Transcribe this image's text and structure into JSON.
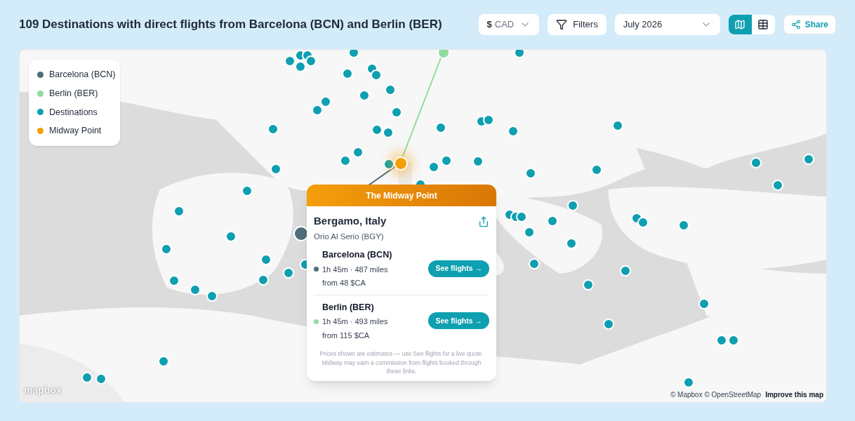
{
  "title": "109 Destinations with direct flights from Barcelona (BCN) and Berlin (BER)",
  "currency": {
    "symbol": "$",
    "code": "CAD"
  },
  "filters_label": "Filters",
  "month": "July 2026",
  "view_toggle": [
    {
      "kind": "map",
      "selected": true
    },
    {
      "kind": "table",
      "selected": false
    }
  ],
  "share_label": "Share",
  "legend": [
    {
      "label": "Barcelona (BCN)",
      "color": "#4f6d7a"
    },
    {
      "label": "Berlin (BER)",
      "color": "#8fdca0"
    },
    {
      "label": "Destinations",
      "color": "#0e9fb0"
    },
    {
      "label": "Midway Point",
      "color": "#f59e0b"
    }
  ],
  "popup": {
    "header": "The Midway Point",
    "place": "Bergamo, Italy",
    "airport": "Orio Al Serio (BGY)",
    "origins": [
      {
        "name": "Barcelona (BCN)",
        "color": "#4f6d7a",
        "trip": "1h 45m · 487 miles",
        "price": "from 48 $CA",
        "button": "See flights →"
      },
      {
        "name": "Berlin (BER)",
        "color": "#8fdca0",
        "trip": "1h 45m · 493 miles",
        "price": "from 115 $CA",
        "button": "See flights →"
      }
    ],
    "disclaimer": "Prices shown are estimates — use See flights for a live quote. Midway may earn a commission from flights booked through these links."
  },
  "attribution": {
    "logo": "mapbox",
    "credits": "© Mapbox © OpenStreetMap",
    "link": "Improve this map"
  }
}
